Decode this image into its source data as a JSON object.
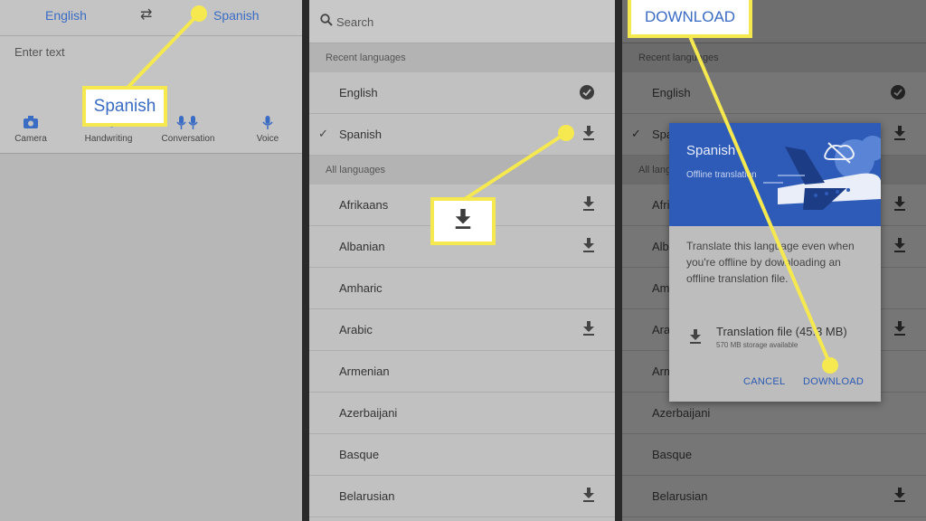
{
  "panel1": {
    "source_lang": "English",
    "target_lang": "Spanish",
    "input_placeholder": "Enter text",
    "tools": [
      {
        "label": "Camera",
        "icon": "camera-icon"
      },
      {
        "label": "Handwriting",
        "icon": "pen-icon"
      },
      {
        "label": "Conversation",
        "icon": "microphones-icon"
      },
      {
        "label": "Voice",
        "icon": "microphone-icon"
      }
    ]
  },
  "callouts": {
    "spanish": "Spanish",
    "download": "DOWNLOAD"
  },
  "panel2": {
    "search_placeholder": "Search",
    "recent_header": "Recent languages",
    "recent": [
      {
        "label": "English",
        "state": "downloaded"
      },
      {
        "label": "Spanish",
        "state": "download",
        "selected": true
      }
    ],
    "all_header": "All languages",
    "all": [
      {
        "label": "Afrikaans",
        "download": true
      },
      {
        "label": "Albanian",
        "download": true
      },
      {
        "label": "Amharic",
        "download": false
      },
      {
        "label": "Arabic",
        "download": true
      },
      {
        "label": "Armenian",
        "download": false
      },
      {
        "label": "Azerbaijani",
        "download": false
      },
      {
        "label": "Basque",
        "download": false
      },
      {
        "label": "Belarusian",
        "download": true
      }
    ]
  },
  "panel3": {
    "recent_header": "Recent languages",
    "all_header": "All languages",
    "rows": [
      "English",
      "Spanish",
      "Afrikaans",
      "Albanian",
      "Amharic",
      "Arabic",
      "Armenian",
      "Azerbaijani",
      "Basque",
      "Belarusian"
    ]
  },
  "dialog": {
    "title": "Spanish",
    "subtitle": "Offline translation",
    "body": "Translate this language even when you're offline by downloading an offline translation file.",
    "file_label": "Translation file (45.3 MB)",
    "storage": "570 MB storage available",
    "cancel": "CANCEL",
    "download": "DOWNLOAD"
  },
  "colors": {
    "accent": "#3a6cc4",
    "callout_border": "#f5e94f",
    "dialog_header": "#2e5bb8"
  }
}
